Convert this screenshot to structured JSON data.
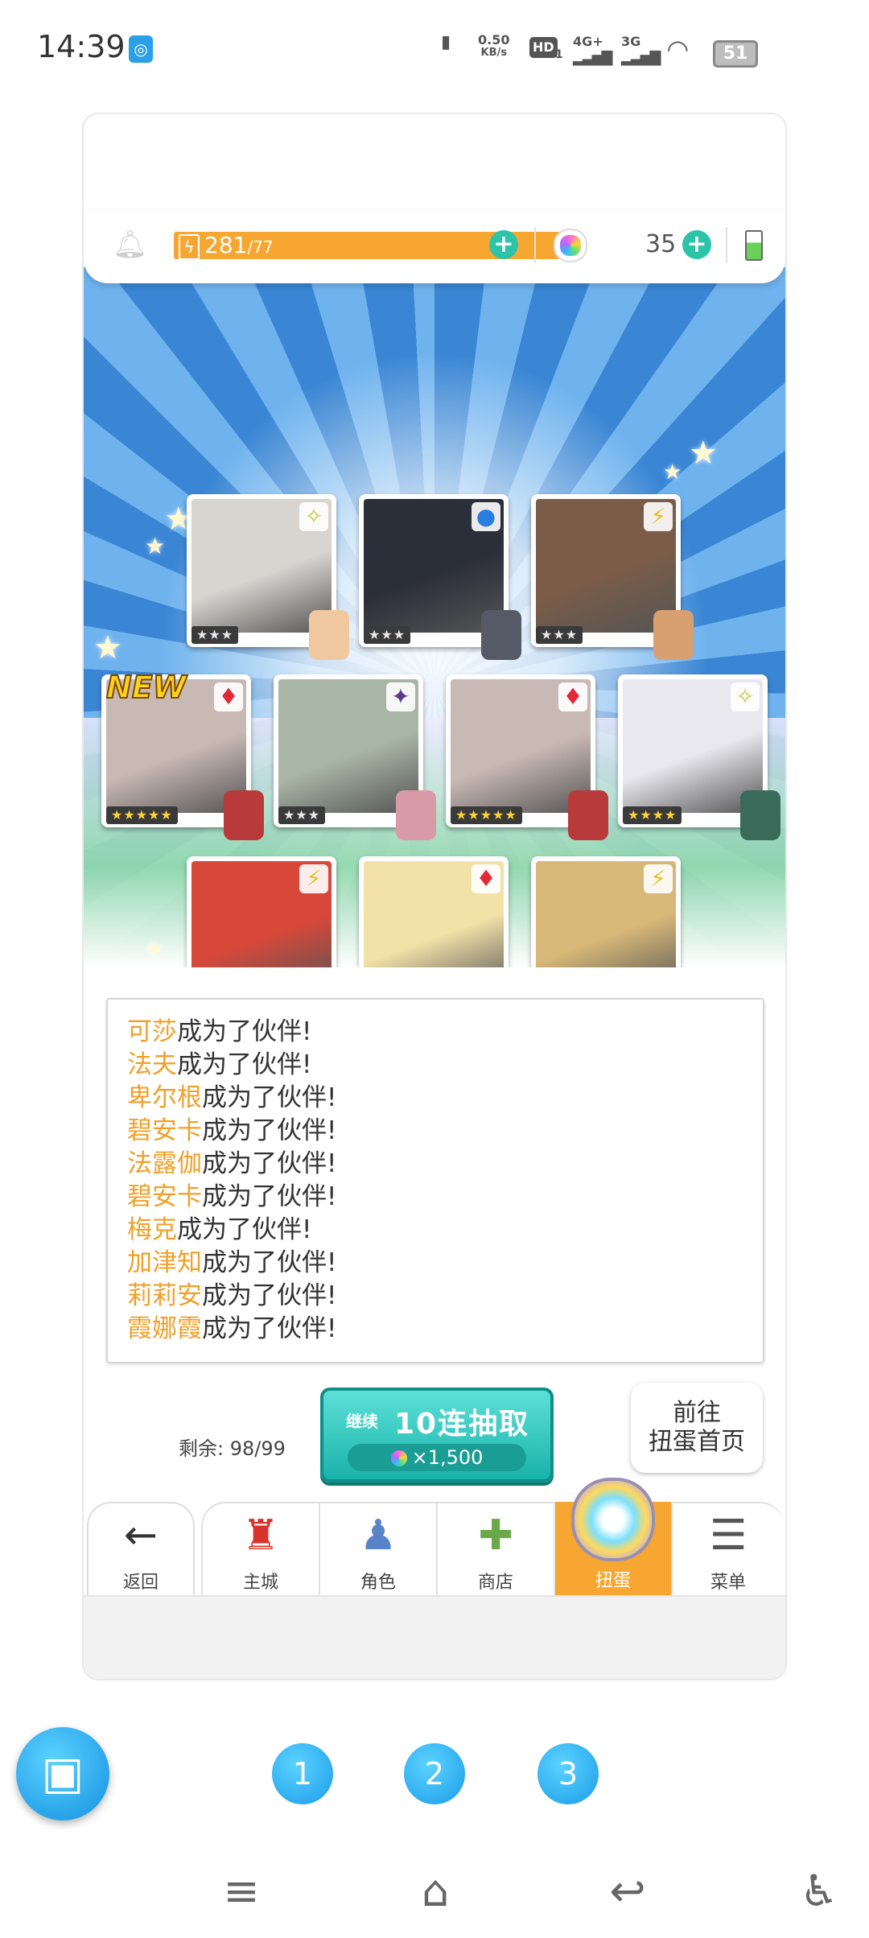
{
  "status_bar": {
    "time": "14:39",
    "app_notification_icon": "app-logo-icon",
    "net_speed_top": "0.50",
    "net_speed_bottom": "KB/s",
    "hd_label": "HD",
    "hd_sub": "1",
    "signal1_label": "4G+",
    "signal2_label": "3G",
    "battery": "51"
  },
  "hud": {
    "stamina": "281",
    "stamina_max": "/77",
    "gems": "35",
    "colors": {
      "stamina_bar": "#f7a731",
      "plus_button": "#2cc4a8"
    }
  },
  "stage": {
    "new_tag": "NEW",
    "cards": [
      {
        "stars": "★★★",
        "badge": "✧",
        "badge_color": "#c8c84a",
        "portrait_color": "#d8d4d0",
        "sprite_color": "#f0c9a0"
      },
      {
        "stars": "★★★",
        "badge": "●",
        "badge_color": "#2a7de0",
        "portrait_color": "#2b2f3a",
        "sprite_color": "#555a66"
      },
      {
        "stars": "★★★",
        "badge": "⚡",
        "badge_color": "#e8c21a",
        "portrait_color": "#7a5c48",
        "sprite_color": "#d8a070"
      },
      {
        "stars": "★★★★★",
        "badge": "♦",
        "badge_color": "#e02a3a",
        "portrait_color": "#c9b9b4",
        "sprite_color": "#b83a3a"
      },
      {
        "stars": "★★★",
        "badge": "✦",
        "badge_color": "#5b3a8a",
        "portrait_color": "#a9b6a6",
        "sprite_color": "#d99aa8"
      },
      {
        "stars": "★★★★★",
        "badge": "♦",
        "badge_color": "#e02a3a",
        "portrait_color": "#c9b9b4",
        "sprite_color": "#b83a3a"
      },
      {
        "stars": "★★★★",
        "badge": "✧",
        "badge_color": "#c8c84a",
        "portrait_color": "#e8e8ee",
        "sprite_color": "#3a6a5a"
      },
      {
        "stars": "★★★",
        "badge": "⚡",
        "badge_color": "#e8c21a",
        "portrait_color": "#d8483a",
        "sprite_color": "#d88a7a"
      },
      {
        "stars": "★★★",
        "badge": "♦",
        "badge_color": "#e02a3a",
        "portrait_color": "#f3e2a8",
        "sprite_color": "#e0b88a"
      },
      {
        "stars": "★★★★",
        "badge": "⚡",
        "badge_color": "#e8c21a",
        "portrait_color": "#d8b878",
        "sprite_color": "#c89a6a"
      }
    ]
  },
  "log": {
    "suffix": "成为了伙伴!",
    "names": [
      "可莎",
      "法夫",
      "卑尔根",
      "碧安卡",
      "法露伽",
      "碧安卡",
      "梅克",
      "加津知",
      "莉莉安",
      "霞娜霞"
    ]
  },
  "gacha": {
    "remaining": "剩余: 98/99",
    "continue_label": "继续",
    "pull_label": "10连抽取",
    "pull_cost": "×1,500",
    "goto_line1": "前往",
    "goto_line2": "扭蛋首页"
  },
  "nav": {
    "back": "返回",
    "main_city": "主城",
    "character": "角色",
    "shop": "商店",
    "gacha": "扭蛋",
    "menu": "菜单"
  },
  "pager": {
    "p1": "1",
    "p2": "2",
    "p3": "3"
  }
}
